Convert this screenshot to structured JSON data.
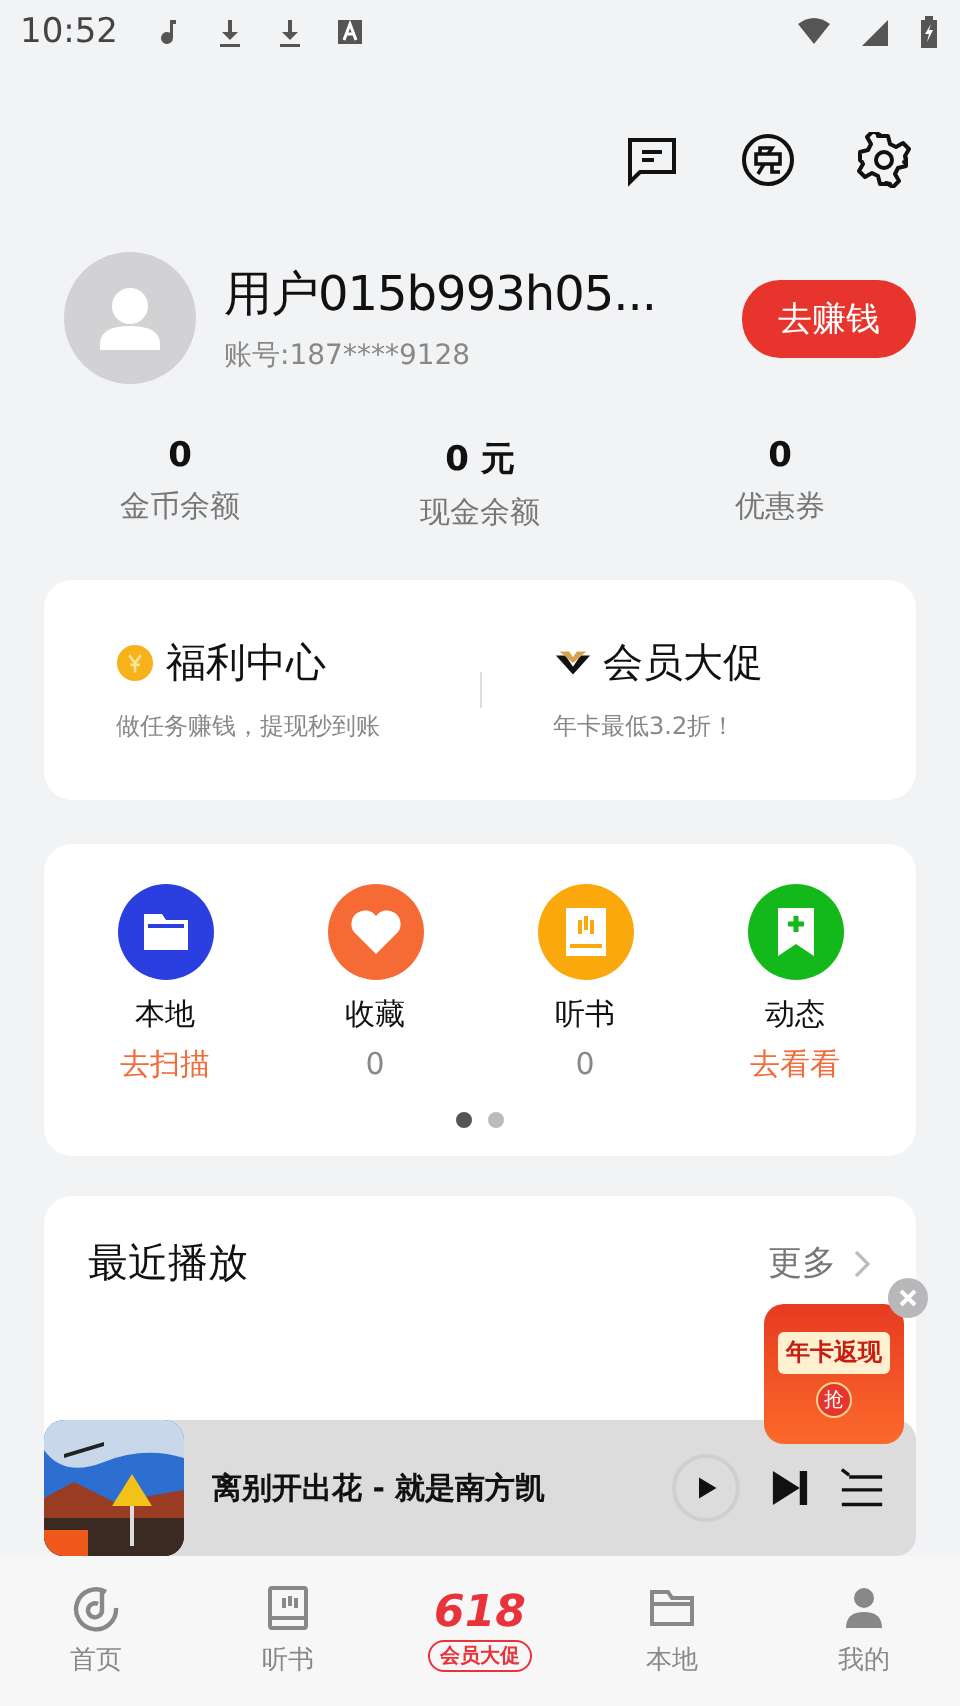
{
  "status_bar": {
    "time": "10:52"
  },
  "profile": {
    "name": "用户015b993h05...",
    "account": "账号:187****9128",
    "earn_button": "去赚钱"
  },
  "stats": [
    {
      "value": "0",
      "label": "金币余额"
    },
    {
      "value": "0 元",
      "label": "现金余额"
    },
    {
      "value": "0",
      "label": "优惠券"
    }
  ],
  "promo_cards": [
    {
      "title": "福利中心",
      "subtitle": "做任务赚钱，提现秒到账"
    },
    {
      "title": "会员大促",
      "subtitle": "年卡最低3.2折！"
    }
  ],
  "shortcuts": [
    {
      "label": "本地",
      "sub": "去扫描",
      "kind": "action",
      "color": "#2b3fe0"
    },
    {
      "label": "收藏",
      "sub": "0",
      "kind": "count",
      "color": "#f56a35"
    },
    {
      "label": "听书",
      "sub": "0",
      "kind": "count",
      "color": "#fba80c"
    },
    {
      "label": "动态",
      "sub": "去看看",
      "kind": "action",
      "color": "#13b81a"
    }
  ],
  "pager": [
    {
      "selected": true
    },
    {
      "selected": false
    }
  ],
  "recent": {
    "title": "最近播放",
    "more": "更多"
  },
  "floating_promo": {
    "title": "年卡返现",
    "action": "抢"
  },
  "mini_player": {
    "track": "离别开出花 - 就是南方凯",
    "playing": false
  },
  "bottom_nav": [
    {
      "label": "首页",
      "selected": false
    },
    {
      "label": "听书",
      "selected": false
    },
    {
      "label": "会员大促",
      "badge": "618",
      "kind": "promo",
      "selected": false
    },
    {
      "label": "本地",
      "selected": false
    },
    {
      "label": "我的",
      "selected": false
    }
  ]
}
